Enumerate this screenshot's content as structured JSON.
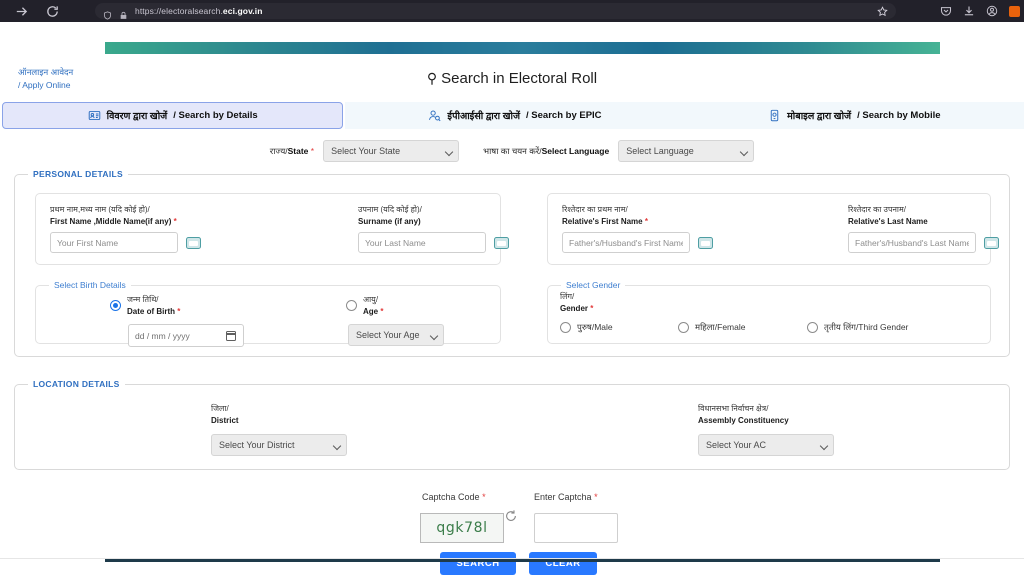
{
  "browser": {
    "url_prefix": "https://electoralsearch.",
    "url_domain": "eci.gov.in",
    "icons": {
      "forward": "forward-arrow-icon",
      "reload": "reload-icon",
      "shield": "shield-icon",
      "lock": "lock-icon",
      "bookmark": "star-icon",
      "pocket": "pocket-icon",
      "downloads": "download-icon",
      "account": "account-icon",
      "extension": "extension-icon"
    }
  },
  "header": {
    "apply_online_hi": "ऑनलाइन आवेदन",
    "apply_online_en": "/ Apply Online",
    "title": "Search in Electoral Roll",
    "search_glyph": "⌕"
  },
  "tabs": [
    {
      "hi": "विवरण द्वारा खोजें",
      "en": "/ Search by Details",
      "icon": "id-card-icon",
      "active": true
    },
    {
      "hi": "ईपीआईसी द्वारा खोजें",
      "en": "/ Search by EPIC",
      "icon": "person-search-icon",
      "active": false
    },
    {
      "hi": "मोबाइल द्वारा खोजें",
      "en": "/ Search by Mobile",
      "icon": "mobile-icon",
      "active": false
    }
  ],
  "toprow": {
    "state_label_hi": "राज्य/",
    "state_label_en": "State",
    "state_value": "Select Your State",
    "language_label_hi": "भाषा का चयन करें/",
    "language_label_en": "Select Language",
    "language_value": "Select Language",
    "required_mark": "*"
  },
  "personal_details": {
    "legend": "PERSONAL DETAILS",
    "first_name": {
      "hi": "प्रथम नाम,मध्य नाम (यदि कोई हो)/",
      "en": "First Name ,Middle Name(if any)",
      "required": "*",
      "placeholder": "Your First Name"
    },
    "surname": {
      "hi": "उपनाम (यदि कोई हो)/",
      "en": "Surname (if any)",
      "required": "",
      "placeholder": "Your Last Name"
    },
    "relative_first_name": {
      "hi": "रिश्तेदार का प्रथम नाम/",
      "en": "Relative's First Name",
      "required": "*",
      "placeholder": "Father's/Husband's First Name"
    },
    "relative_last_name": {
      "hi": "रिश्तेदार का उपनाम/",
      "en": "Relative's Last Name",
      "required": "",
      "placeholder": "Father's/Husband's Last Name"
    },
    "birth": {
      "legend": "Select Birth Details",
      "dob_hi": "जन्म तिथि/",
      "dob_en": "Date of Birth",
      "dob_required": "*",
      "dob_value": "dd / mm / yyyy",
      "age_hi": "आयु/",
      "age_en": "Age",
      "age_required": "*",
      "age_value": "Select Your Age",
      "selected": "date_of_birth"
    },
    "gender": {
      "legend": "Select Gender",
      "label_hi": "लिंग/",
      "label_en": "Gender",
      "required": "*",
      "options": [
        {
          "hi": "पुरुष",
          "en": "/Male",
          "selected": false
        },
        {
          "hi": "महिला",
          "en": "/Female",
          "selected": false
        },
        {
          "hi": "तृतीय लिंग",
          "en": "/Third Gender",
          "selected": false
        }
      ]
    }
  },
  "location_details": {
    "legend": "LOCATION DETAILS",
    "district": {
      "hi": "जिला/",
      "en": "District",
      "value": "Select Your District"
    },
    "assembly_constituency": {
      "hi": "विधानसभा निर्वाचन क्षेत्र/",
      "en": "Assembly Constituency",
      "value": "Select Your AC"
    }
  },
  "captcha": {
    "code_label": "Captcha Code",
    "code_required": "*",
    "code_value": "qgk78l",
    "enter_label": "Enter Captcha",
    "enter_required": "*",
    "enter_value": "",
    "refresh_icon": "refresh-icon"
  },
  "actions": {
    "search_label": "SEARCH",
    "clear_label": "CLEAR"
  },
  "colors": {
    "accent_blue": "#2f6fc0",
    "button_blue": "#2979ff",
    "required_red": "#e23b3b",
    "captcha_green": "#3b7d4a",
    "banner_teal": "#3aa98c"
  }
}
